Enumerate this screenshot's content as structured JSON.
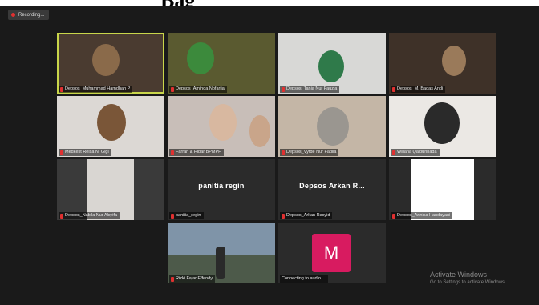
{
  "heading": "Bag",
  "recording": {
    "label": "Recording..."
  },
  "participants": [
    {
      "name": "Depsos_Muhammad Hamdhan P",
      "type": "video",
      "active": true,
      "bg": "#5a4a3a"
    },
    {
      "name": "Depsos_Aminda Nofarija",
      "type": "video",
      "bg": "#6b6a3a"
    },
    {
      "name": "Depsos_Tania Nur Fauzia",
      "type": "video",
      "bg": "#d8d8d6"
    },
    {
      "name": "Depsos_M. Bagas Andi",
      "type": "video",
      "bg": "#4a3a30"
    },
    {
      "name": "Medkest Reisa N. Gigi",
      "type": "video",
      "bg": "#d9d4cf"
    },
    {
      "name": "Farrah & Hibar BPMPH",
      "type": "video",
      "bg": "#cfc5c0"
    },
    {
      "name": "Depsos_Vyfde Nur Fadila",
      "type": "video",
      "bg": "#c9beb0"
    },
    {
      "name": "Wiliana Qalbunnada",
      "type": "video",
      "bg": "#e9e6e2"
    },
    {
      "name": "Depsos_Nabila Nur Alsyifa",
      "type": "video",
      "bg": "#3a3a3a"
    },
    {
      "name": "panitia_regin",
      "type": "name",
      "display": "panitia regin"
    },
    {
      "name": "Depsos_Arkan Rasyid",
      "type": "name",
      "display": "Depsos Arkan R..."
    },
    {
      "name": "Depsos_Annisa Handayani",
      "type": "white"
    },
    {
      "name": "Rizki Fajar Effendy",
      "type": "video",
      "bg": "#7f94a8"
    },
    {
      "name": "Connecting to audio ...",
      "type": "avatar",
      "initial": "M"
    }
  ],
  "watermark": {
    "title": "Activate Windows",
    "subtitle": "Go to Settings to activate Windows."
  }
}
